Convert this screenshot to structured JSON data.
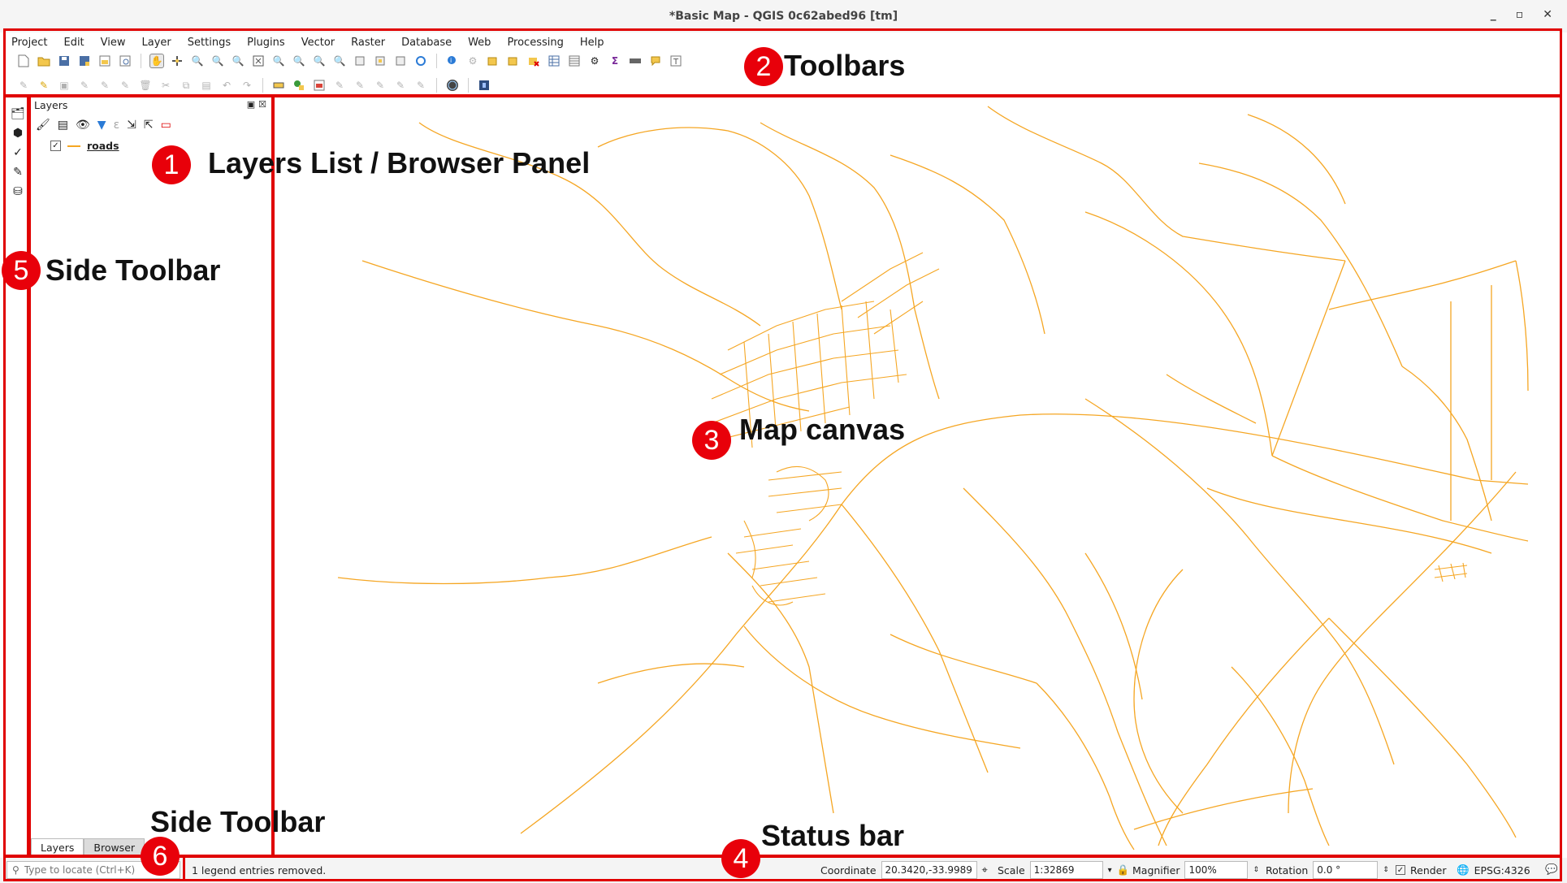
{
  "window": {
    "title": "*Basic Map - QGIS 0c62abed96 [tm]",
    "controls": [
      "_",
      "▫",
      "✕"
    ]
  },
  "menu": [
    "Project",
    "Edit",
    "View",
    "Layer",
    "Settings",
    "Plugins",
    "Vector",
    "Raster",
    "Database",
    "Web",
    "Processing",
    "Help"
  ],
  "layers_panel": {
    "title": "Layers",
    "layer": {
      "name": "roads",
      "checked": "✓"
    },
    "tabs": [
      "Layers",
      "Browser"
    ]
  },
  "status": {
    "locator_placeholder": "Type to locate (Ctrl+K)",
    "message": "1 legend entries removed.",
    "coordinate_label": "Coordinate",
    "coordinate_value": "20.3420,-33.9989",
    "scale_label": "Scale",
    "scale_value": "1:32869",
    "magnifier_label": "Magnifier",
    "magnifier_value": "100%",
    "rotation_label": "Rotation",
    "rotation_value": "0.0 °",
    "render_label": "Render",
    "crs": "EPSG:4326"
  },
  "annotations": {
    "n1": "1",
    "n1_label": "Layers List / Browser Panel",
    "n2": "2",
    "n2_label": "Toolbars",
    "n3": "3",
    "n3_label": "Map canvas",
    "n4": "4",
    "n4_label": "Status bar",
    "n5": "5",
    "n5_label": "Side Toolbar",
    "n6": "6",
    "n6_label": "Side Toolbar"
  },
  "colors": {
    "road": "#f5a623",
    "annotation": "#e00000"
  }
}
